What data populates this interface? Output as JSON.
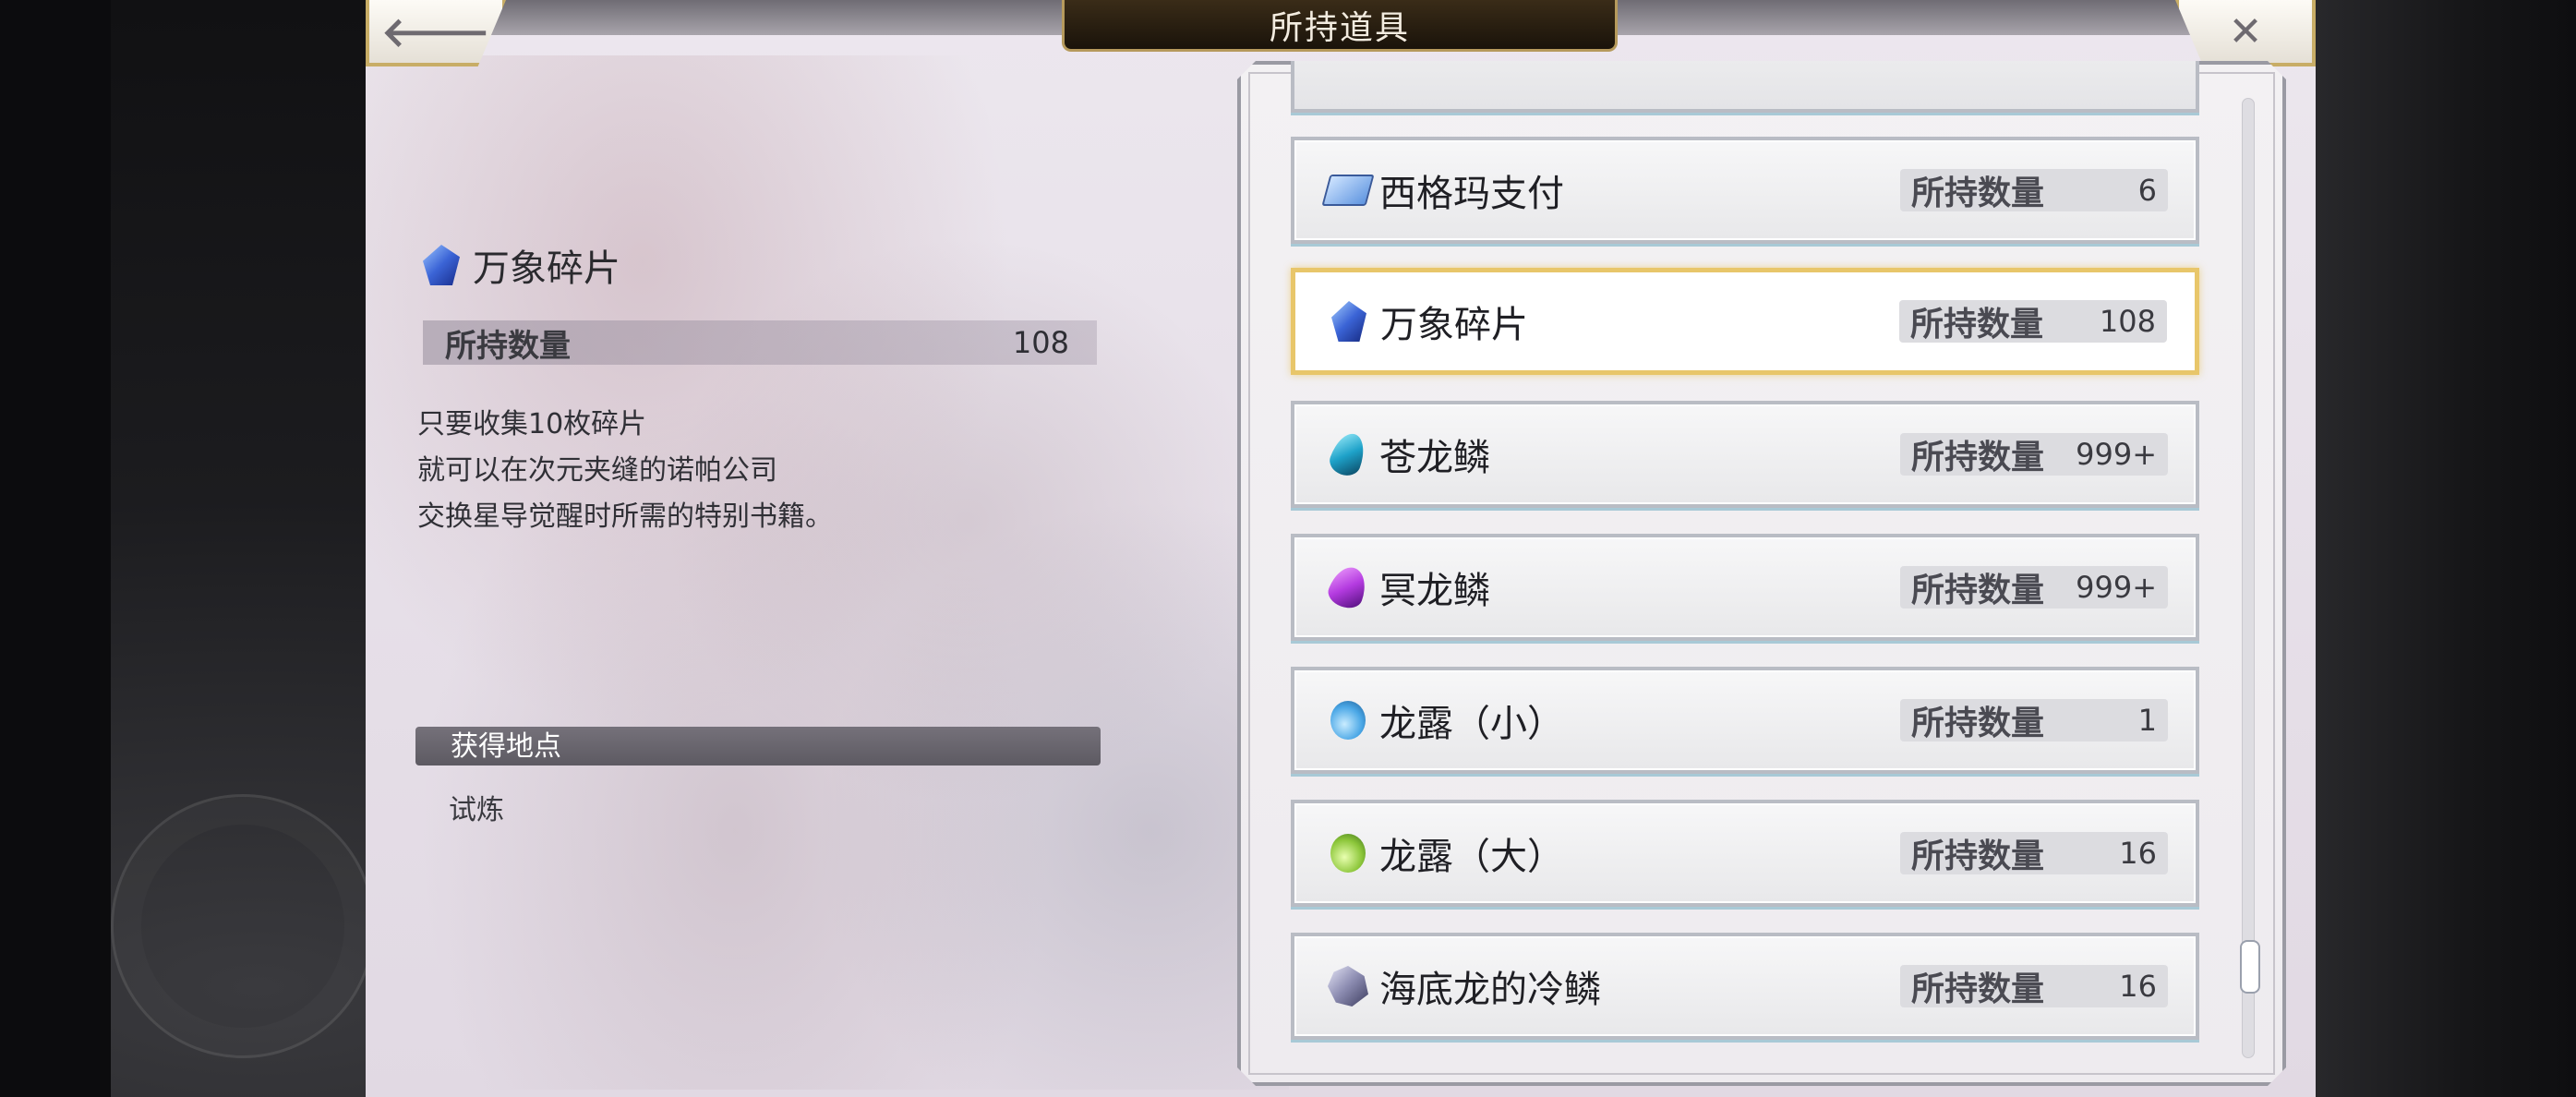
{
  "header": {
    "title": "所持道具",
    "back_label": "🡐",
    "close_label": "✕"
  },
  "detail": {
    "item_name": "万象碎片",
    "count_label": "所持数量",
    "count_value": "108",
    "description": [
      "只要收集10枚碎片",
      "就可以在次元夹缝的诺帕公司",
      "交换星导觉醒时所需的特别书籍。"
    ],
    "source_header": "获得地点",
    "source_item": "试炼"
  },
  "list": {
    "items": [
      {
        "name": "西格玛支付",
        "qty_label": "所持数量",
        "qty": "6",
        "icon": "card-icon",
        "selected": false
      },
      {
        "name": "万象碎片",
        "qty_label": "所持数量",
        "qty": "108",
        "icon": "shard-icon",
        "selected": true
      },
      {
        "name": "苍龙鳞",
        "qty_label": "所持数量",
        "qty": "999+",
        "icon": "cyan-scale-icon",
        "selected": false
      },
      {
        "name": "冥龙鳞",
        "qty_label": "所持数量",
        "qty": "999+",
        "icon": "purple-scale-icon",
        "selected": false
      },
      {
        "name": "龙露（小）",
        "qty_label": "所持数量",
        "qty": "1",
        "icon": "blue-potion-icon",
        "selected": false
      },
      {
        "name": "龙露（大）",
        "qty_label": "所持数量",
        "qty": "16",
        "icon": "green-potion-icon",
        "selected": false
      },
      {
        "name": "海底龙的冷鳞",
        "qty_label": "所持数量",
        "qty": "16",
        "icon": "crystal-scale-icon",
        "selected": false
      }
    ]
  },
  "colors": {
    "selected_border": "#e8c66a",
    "title_bar_bg": "#1a130a",
    "accent_gold": "#c8ad66"
  }
}
